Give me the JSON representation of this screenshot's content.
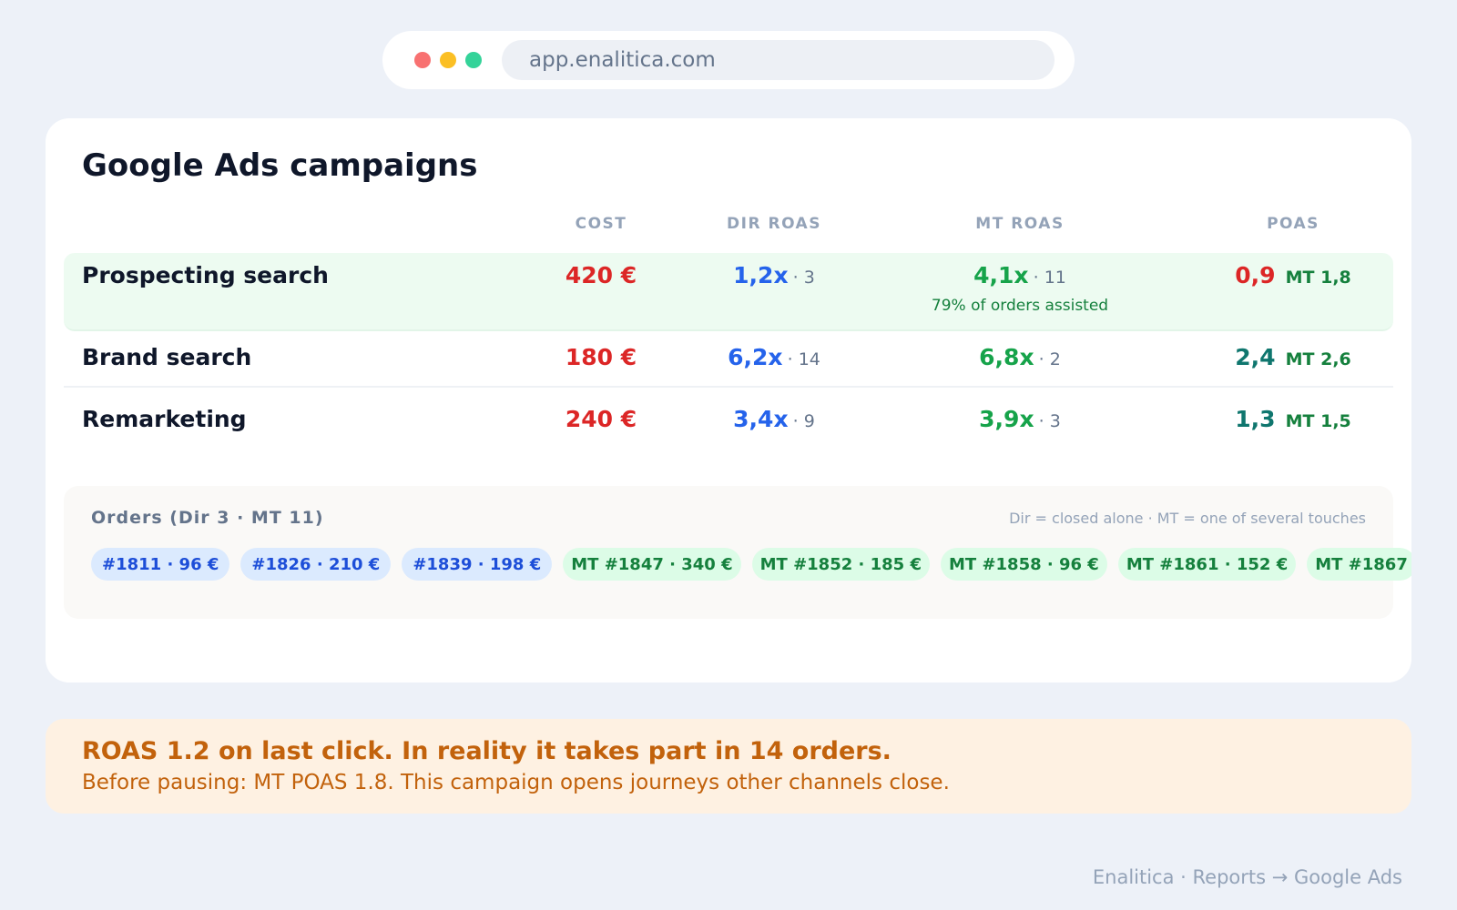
{
  "browser": {
    "url": "app.enalitica.com"
  },
  "card": {
    "title": "Google Ads campaigns",
    "columns": {
      "cost": "COST",
      "dir_roas": "DIR ROAS",
      "mt_roas": "MT ROAS",
      "poas": "POAS"
    },
    "rows": [
      {
        "name": "Prospecting search",
        "cost": "420 €",
        "dir_roas": "1,2x",
        "dir_orders": "· 3",
        "mt_roas": "4,1x",
        "mt_orders": "· 11",
        "mt_note": "79% of orders assisted",
        "poas": "0,9",
        "poas_mt": "MT 1,8"
      },
      {
        "name": "Brand search",
        "cost": "180 €",
        "dir_roas": "6,2x",
        "dir_orders": "· 14",
        "mt_roas": "6,8x",
        "mt_orders": "· 2",
        "poas": "2,4",
        "poas_mt": "MT 2,6"
      },
      {
        "name": "Remarketing",
        "cost": "240 €",
        "dir_roas": "3,4x",
        "dir_orders": "· 9",
        "mt_roas": "3,9x",
        "mt_orders": "· 3",
        "poas": "1,3",
        "poas_mt": "MT 1,5"
      }
    ]
  },
  "orders": {
    "title": "Orders (Dir 3 · MT 11)",
    "legend": "Dir = closed alone · MT = one of several touches",
    "dir_chips": [
      "#1811 · 96 €",
      "#1826 · 210 €",
      "#1839 · 198 €"
    ],
    "mt_chips": [
      "MT #1847 · 340 €",
      "MT #1852 · 185 €",
      "MT #1858 · 96 €",
      "MT #1861 · 152 €",
      "MT #1867"
    ]
  },
  "alert": {
    "title": "ROAS 1.2 on last click. In reality it takes part in 14 orders.",
    "body": "Before pausing: MT POAS 1.8. This campaign opens journeys other channels close."
  },
  "footer": {
    "breadcrumb": "Enalitica · Reports → Google Ads"
  },
  "colors": {
    "cost": "#dc2626",
    "dir": "#2563eb",
    "mt": "#16a34a",
    "alert": "#c2620c"
  }
}
